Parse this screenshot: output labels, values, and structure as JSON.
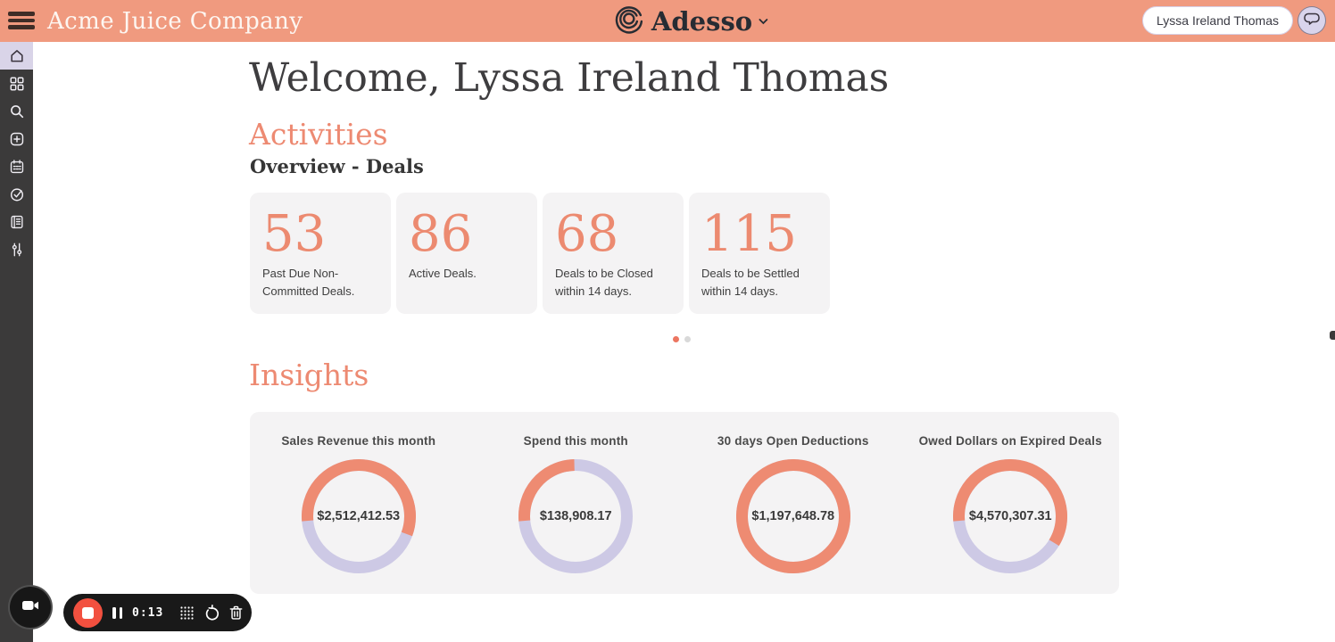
{
  "header": {
    "app_title": "Acme Juice Company",
    "logo_text": "Adesso",
    "user_name": "Lyssa Ireland Thomas"
  },
  "sidebar": {
    "items": [
      {
        "icon": "home",
        "active": true
      },
      {
        "icon": "apps-grid",
        "active": false
      },
      {
        "icon": "search",
        "active": false
      },
      {
        "icon": "add-square",
        "active": false
      },
      {
        "icon": "calendar",
        "active": false
      },
      {
        "icon": "tasks-check",
        "active": false
      },
      {
        "icon": "notebook",
        "active": false
      },
      {
        "icon": "sliders",
        "active": false
      }
    ]
  },
  "main": {
    "welcome_title": "Welcome, Lyssa Ireland Thomas",
    "activities": {
      "title": "Activities",
      "subtitle": "Overview - Deals",
      "stats": [
        {
          "value": "53",
          "label": "Past Due Non-Committed Deals."
        },
        {
          "value": "86",
          "label": "Active Deals."
        },
        {
          "value": "68",
          "label": "Deals to be Closed within 14 days."
        },
        {
          "value": "115",
          "label": "Deals to be Settled within 14 days."
        }
      ],
      "pagination": {
        "dot_count": 2,
        "active_index": 0
      }
    },
    "insights": {
      "title": "Insights"
    }
  },
  "chart_data": [
    {
      "type": "donut",
      "title": "Sales Revenue this month",
      "value_label": "$2,512,412.53",
      "filled_fraction": 0.57,
      "start_angle_deg": 265,
      "colors": {
        "filled": "#ee8b72",
        "track": "#cdc9e5"
      }
    },
    {
      "type": "donut",
      "title": "Spend this month",
      "value_label": "$138,908.17",
      "filled_fraction": 0.26,
      "start_angle_deg": 265,
      "colors": {
        "filled": "#ee8b72",
        "track": "#cdc9e5"
      }
    },
    {
      "type": "donut",
      "title": "30 days Open Deductions",
      "value_label": "$1,197,648.78",
      "filled_fraction": 1.0,
      "start_angle_deg": 265,
      "colors": {
        "filled": "#ee8b72",
        "track": "#cdc9e5"
      }
    },
    {
      "type": "donut",
      "title": "Owed Dollars on Expired Deals",
      "value_label": "$4,570,307.31",
      "filled_fraction": 0.6,
      "start_angle_deg": 265,
      "colors": {
        "filled": "#ee8b72",
        "track": "#cdc9e5"
      }
    }
  ],
  "recorder": {
    "timer": "0:13",
    "buttons": [
      "video-camera",
      "stop",
      "pause",
      "drag-dots",
      "restart",
      "delete"
    ]
  },
  "colors": {
    "header_bg": "#f09a7f",
    "accent_salmon": "#ec8a70",
    "track_lavender": "#cdc9e5",
    "sidebar_bg": "#3b3a3a",
    "active_item_bg": "#d9d4e8",
    "card_bg": "#f4f3f4",
    "record_red": "#f2503f"
  }
}
